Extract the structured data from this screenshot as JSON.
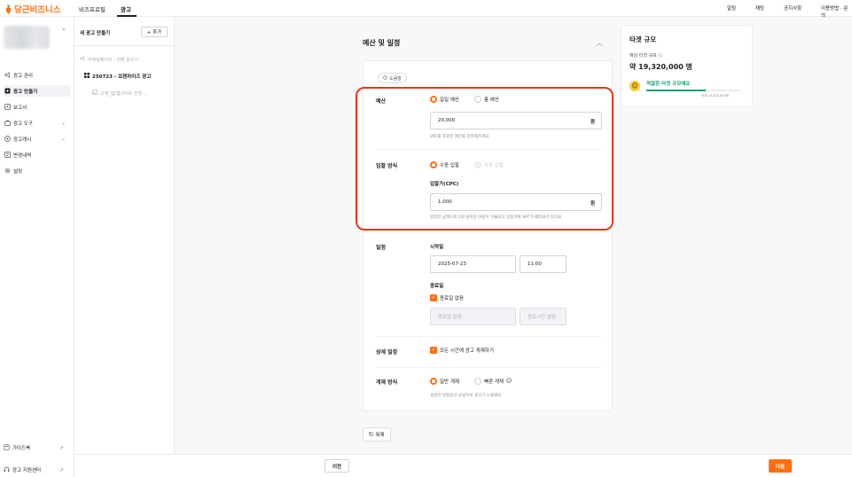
{
  "header": {
    "brand": "당근비즈니스",
    "tabs": [
      {
        "label": "비즈프로필"
      },
      {
        "label": "광고"
      }
    ],
    "right": [
      "알림",
      "채팅",
      "공지사항",
      "이용방법 · 문의"
    ]
  },
  "sidebar": {
    "items": [
      {
        "label": "광고 관리"
      },
      {
        "label": "광고 만들기"
      },
      {
        "label": "보고서"
      },
      {
        "label": "광고 도구"
      },
      {
        "label": "광고캐시"
      },
      {
        "label": "변경내역"
      },
      {
        "label": "설정"
      }
    ],
    "bottom": [
      {
        "label": "가이드북"
      },
      {
        "label": "광고 지원센터"
      }
    ]
  },
  "adlist": {
    "title": "새 광고 만들기",
    "add_label": "+ 추가",
    "items": [
      {
        "label": "마케팅페이지 - 전환 늘리기 ..."
      },
      {
        "label": "250723 - 프랜차이즈 광고"
      },
      {
        "label": "소재_앱/웹사이트 전환 ..."
      }
    ]
  },
  "section": {
    "title": "예산 및 일정",
    "help_label": "도움말",
    "budget": {
      "label": "예산",
      "options": [
        "일일 예산",
        "총 예산"
      ],
      "value": "20,000",
      "unit": "원",
      "hint": "VAT를 포함한 예산을 입력해주세요."
    },
    "bidding": {
      "label": "입찰 방식",
      "options": [
        "수동 입찰",
        "자동 입찰"
      ],
      "sub_label": "입찰가(CPC)",
      "value": "1,000",
      "unit": "원",
      "hint": "입력한 금액으로 1회 클릭당 비용이 지불되고 입찰가에 VAT가 예외되어 있어요."
    },
    "schedule": {
      "label": "일정",
      "start_label": "시작일",
      "start_date": "2025-07-23",
      "start_time": "11:00",
      "end_label": "종료일",
      "no_end_label": "종료일 없음",
      "end_date_placeholder": "종료일 없음",
      "end_time_placeholder": "종료시간 없음"
    },
    "detail": {
      "label": "상세 일정",
      "check_label": "모든 시간에 광고 게재하기"
    },
    "delivery": {
      "label": "게재 방식",
      "options": [
        "일반 게재",
        "빠른 게재"
      ],
      "hint": "설정한 일정동안 균형하게 광고가 노출돼요."
    },
    "copy_label": "복제"
  },
  "target": {
    "title": "타겟 규모",
    "sub": "예상 타겟 규모",
    "count": "약 19,320,000 명",
    "status": "적절한 타겟 규모예요",
    "total": "전체 19,320,000명",
    "fill_ratio": 0.63
  },
  "footer": {
    "prev_label": "이전",
    "next_label": "다음"
  },
  "colors": {
    "brand": "#ff6f0f",
    "highlight": "#e8341a",
    "good": "#1aa174"
  }
}
